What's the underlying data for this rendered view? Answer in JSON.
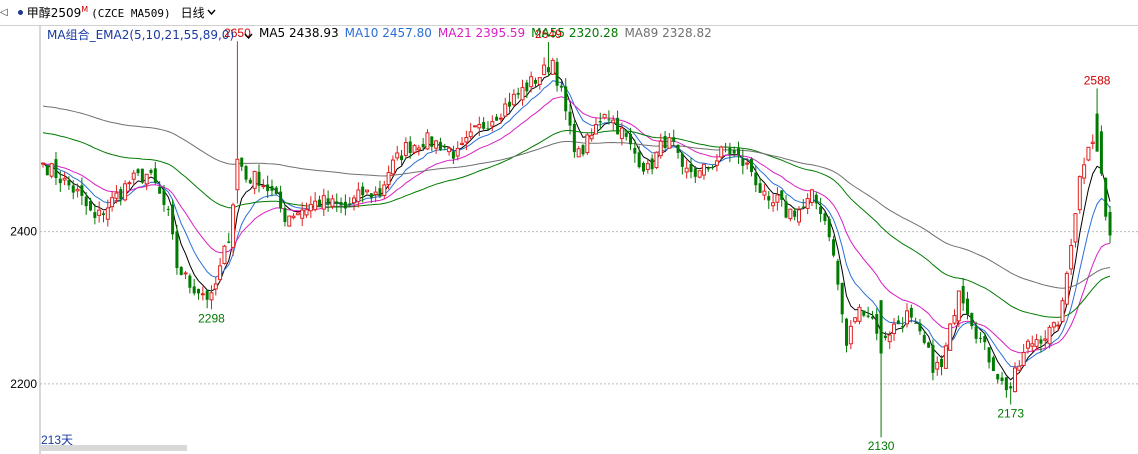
{
  "toolbar": {
    "back_symbol": "◁",
    "instrument_name": "甲醇2509",
    "instrument_flag": "M",
    "instrument_code": "(CZCE MA509)",
    "period": "日线"
  },
  "legend": {
    "group": "MA组合_EMA2(5,10,21,55,89,0)",
    "items": [
      {
        "label": "MA5 2438.93",
        "color": "#000000"
      },
      {
        "label": "MA10 2457.80",
        "color": "#2a6fd6"
      },
      {
        "label": "MA21 2395.59",
        "color": "#d81fc4"
      },
      {
        "label": "MA55 2320.28",
        "color": "#007a00"
      },
      {
        "label": "MA89 2328.82",
        "color": "#707070"
      }
    ]
  },
  "footer": {
    "bar_count": "213天"
  },
  "colors": {
    "up": "#e02020",
    "down": "#007a00",
    "grid": "#bbbbbb"
  },
  "chart_data": {
    "type": "candlestick",
    "y_ticks": [
      2400,
      2200
    ],
    "ylim": [
      2108,
      2670
    ],
    "annotations": [
      {
        "label": "2650",
        "index": 45,
        "value": 2650,
        "kind": "high"
      },
      {
        "label": "2298",
        "index": 39,
        "value": 2298,
        "kind": "low"
      },
      {
        "label": "2649",
        "index": 117,
        "value": 2649,
        "kind": "high"
      },
      {
        "label": "2130",
        "index": 194,
        "value": 2130,
        "kind": "low"
      },
      {
        "label": "2173",
        "index": 224,
        "value": 2173,
        "kind": "low"
      },
      {
        "label": "2588",
        "index": 244,
        "value": 2588,
        "kind": "high"
      }
    ],
    "close_anchors": [
      [
        0,
        2490
      ],
      [
        8,
        2450
      ],
      [
        12,
        2415
      ],
      [
        16,
        2440
      ],
      [
        20,
        2465
      ],
      [
        24,
        2475
      ],
      [
        26,
        2460
      ],
      [
        29,
        2420
      ],
      [
        31,
        2355
      ],
      [
        34,
        2330
      ],
      [
        37,
        2320
      ],
      [
        39,
        2310
      ],
      [
        41,
        2350
      ],
      [
        43,
        2395
      ],
      [
        44,
        2440
      ],
      [
        45,
        2500
      ],
      [
        47,
        2470
      ],
      [
        50,
        2470
      ],
      [
        53,
        2450
      ],
      [
        56,
        2420
      ],
      [
        60,
        2430
      ],
      [
        64,
        2440
      ],
      [
        70,
        2430
      ],
      [
        74,
        2450
      ],
      [
        78,
        2450
      ],
      [
        80,
        2480
      ],
      [
        84,
        2510
      ],
      [
        88,
        2520
      ],
      [
        92,
        2515
      ],
      [
        96,
        2500
      ],
      [
        100,
        2530
      ],
      [
        104,
        2550
      ],
      [
        108,
        2570
      ],
      [
        112,
        2590
      ],
      [
        116,
        2610
      ],
      [
        118,
        2625
      ],
      [
        120,
        2580
      ],
      [
        122,
        2530
      ],
      [
        124,
        2500
      ],
      [
        127,
        2525
      ],
      [
        130,
        2560
      ],
      [
        134,
        2530
      ],
      [
        136,
        2510
      ],
      [
        140,
        2480
      ],
      [
        144,
        2520
      ],
      [
        146,
        2510
      ],
      [
        148,
        2475
      ],
      [
        150,
        2480
      ],
      [
        152,
        2475
      ],
      [
        156,
        2495
      ],
      [
        158,
        2510
      ],
      [
        160,
        2500
      ],
      [
        164,
        2480
      ],
      [
        168,
        2430
      ],
      [
        170,
        2440
      ],
      [
        172,
        2425
      ],
      [
        176,
        2430
      ],
      [
        178,
        2445
      ],
      [
        180,
        2430
      ],
      [
        182,
        2400
      ],
      [
        184,
        2330
      ],
      [
        186,
        2250
      ],
      [
        188,
        2290
      ],
      [
        190,
        2300
      ],
      [
        192,
        2285
      ],
      [
        194,
        2260
      ],
      [
        196,
        2270
      ],
      [
        198,
        2280
      ],
      [
        200,
        2290
      ],
      [
        202,
        2270
      ],
      [
        204,
        2250
      ],
      [
        206,
        2225
      ],
      [
        208,
        2220
      ],
      [
        210,
        2270
      ],
      [
        212,
        2330
      ],
      [
        214,
        2300
      ],
      [
        216,
        2270
      ],
      [
        218,
        2245
      ],
      [
        220,
        2225
      ],
      [
        222,
        2200
      ],
      [
        224,
        2195
      ],
      [
        226,
        2225
      ],
      [
        228,
        2250
      ],
      [
        230,
        2260
      ],
      [
        232,
        2265
      ],
      [
        234,
        2270
      ],
      [
        236,
        2300
      ],
      [
        238,
        2390
      ],
      [
        240,
        2470
      ],
      [
        242,
        2520
      ],
      [
        244,
        2525
      ],
      [
        245,
        2475
      ],
      [
        246,
        2420
      ],
      [
        247,
        2395
      ]
    ]
  }
}
